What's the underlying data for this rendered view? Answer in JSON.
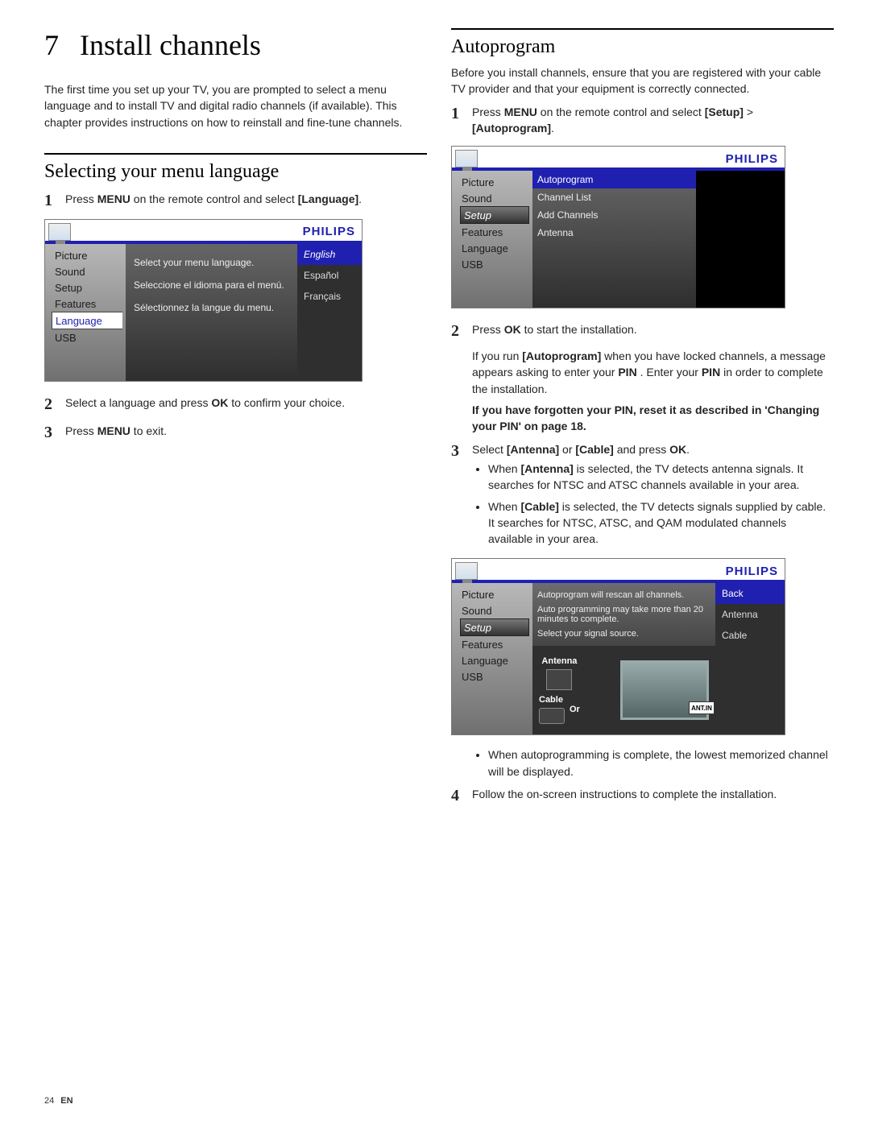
{
  "chapter": {
    "num": "7",
    "title": "Install channels"
  },
  "intro": "The first time you set up your TV, you are prompted to select a menu language and to install TV and digital radio channels (if available). This chapter provides instructions on how to reinstall and fine-tune channels.",
  "brand": "PHILIPS",
  "left_section": {
    "title": "Selecting your menu language",
    "step1_a": "Press ",
    "step1_b": "MENU",
    "step1_c": " on the remote control and select ",
    "step1_d": "[Language]",
    "step1_e": ".",
    "step2_a": "Select a language and press ",
    "step2_b": "OK",
    "step2_c": " to confirm your choice.",
    "step3_a": "Press ",
    "step3_b": "MENU",
    "step3_c": " to exit.",
    "shot": {
      "menu": [
        "Picture",
        "Sound",
        "Setup",
        "Features",
        "Language",
        "USB"
      ],
      "active": "Language",
      "midrows": [
        "Select your menu language.",
        "Seleccione el idioma para el menú.",
        "Sélectionnez la langue du menu."
      ],
      "rightrows": [
        "English",
        "Español",
        "Français"
      ],
      "righthl": "English"
    }
  },
  "right_section": {
    "title": "Autoprogram",
    "intro": "Before you install channels, ensure that you are registered with your cable TV provider and that your equipment is correctly connected.",
    "step1_a": "Press ",
    "step1_b": "MENU",
    "step1_c": " on the remote control and select ",
    "step1_d": "[Setup]",
    "step1_e": " > ",
    "step1_f": "[Autoprogram]",
    "step1_g": ".",
    "step2_a": "Press ",
    "step2_b": "OK",
    "step2_c": " to start the installation.",
    "note1_a": "If you run ",
    "note1_b": "[Autoprogram]",
    "note1_c": " when you have locked channels, a message appears asking to enter your ",
    "note1_d": "PIN",
    "note1_e": " . Enter your ",
    "note1_f": "PIN",
    "note1_g": " in order to complete the installation.",
    "note2": "If you have forgotten your PIN, reset it as described in 'Changing your PIN' on page 18.",
    "step3_a": "Select ",
    "step3_b": "[Antenna]",
    "step3_c": " or ",
    "step3_d": "[Cable]",
    "step3_e": " and press ",
    "step3_f": "OK",
    "step3_g": ".",
    "bullet1_a": "When ",
    "bullet1_b": "[Antenna]",
    "bullet1_c": " is selected, the TV detects antenna signals. It searches for NTSC and ATSC channels available in your area.",
    "bullet2_a": "When ",
    "bullet2_b": "[Cable]",
    "bullet2_c": " is selected, the TV detects signals supplied by cable. It searches for NTSC, ATSC, and QAM modulated channels available in your area.",
    "bullet3": "When autoprogramming is complete, the lowest memorized channel will be displayed.",
    "step4": "Follow the on-screen instructions to complete the installation.",
    "shot1": {
      "menu": [
        "Picture",
        "Sound",
        "Setup",
        "Features",
        "Language",
        "USB"
      ],
      "active": "Setup",
      "mid": [
        "Autoprogram",
        "Channel List",
        "Add Channels",
        "Antenna"
      ],
      "midhl": "Autoprogram"
    },
    "shot2": {
      "menu": [
        "Picture",
        "Sound",
        "Setup",
        "Features",
        "Language",
        "USB"
      ],
      "active": "Setup",
      "note_lines": [
        "Autoprogram will rescan all channels.",
        "Auto programming  may take more than 20 minutes to complete.",
        "Select your signal source."
      ],
      "right": [
        "Back",
        "Antenna",
        "Cable"
      ],
      "righthl": "Back",
      "diag": {
        "ant": "Antenna",
        "cable": "Cable",
        "or": "Or",
        "antin": "ANT.IN"
      }
    }
  },
  "footer": {
    "page": "24",
    "lang": "EN"
  }
}
